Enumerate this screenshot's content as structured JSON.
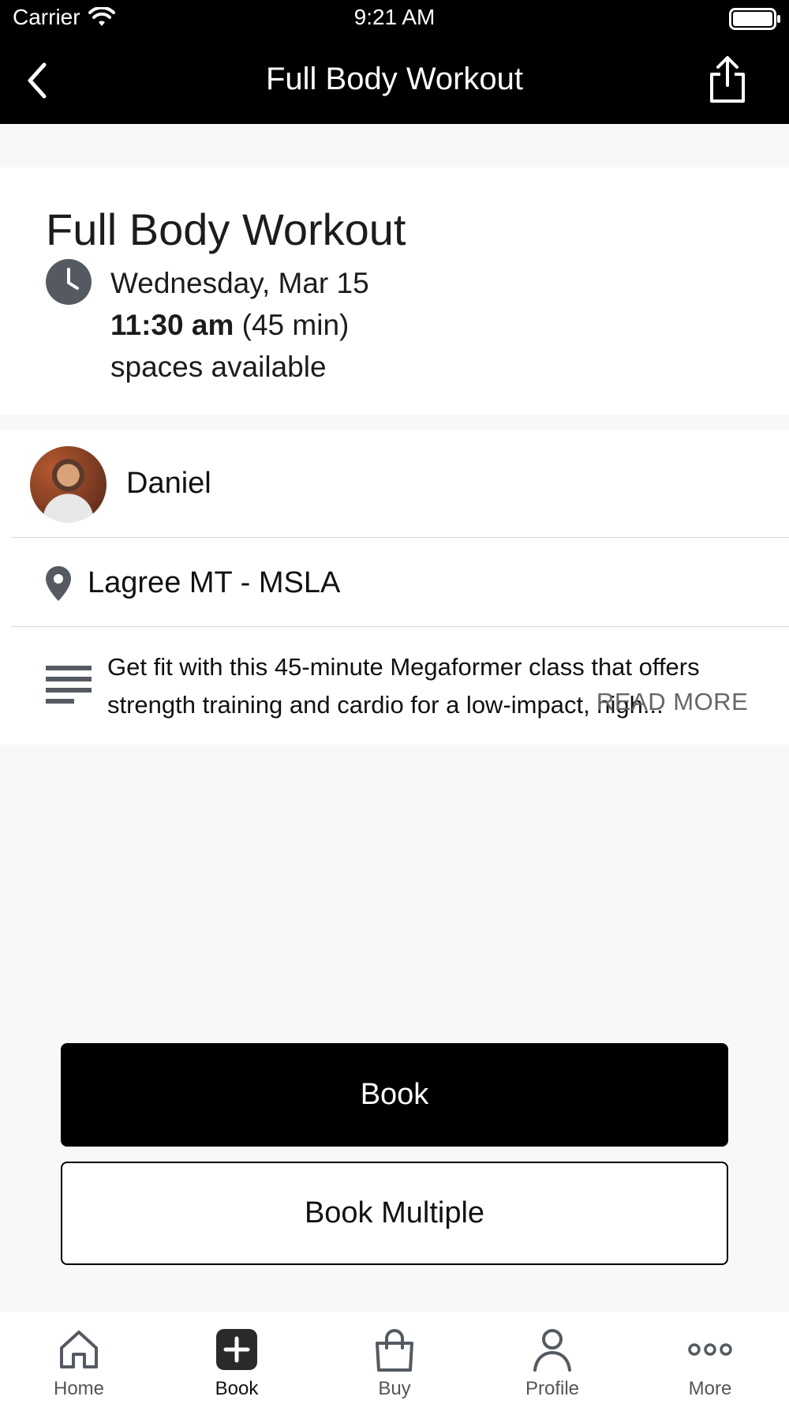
{
  "status_bar": {
    "carrier": "Carrier",
    "time": "9:21 AM"
  },
  "nav": {
    "title": "Full Body Workout"
  },
  "class": {
    "title": "Full Body Workout",
    "date": "Wednesday, Mar 15",
    "time": "11:30 am",
    "duration": "(45 min)",
    "availability": "spaces available"
  },
  "instructor": {
    "name": "Daniel"
  },
  "location": {
    "name": "Lagree MT - MSLA"
  },
  "description": {
    "text": "Get fit with this 45-minute Megaformer class that offers strength training and cardio for a low-impact, high...",
    "read_more": "READ MORE"
  },
  "buttons": {
    "book": "Book",
    "book_multiple": "Book Multiple"
  },
  "tabs": [
    {
      "label": "Home",
      "icon": "home-icon"
    },
    {
      "label": "Book",
      "icon": "plus-square-icon"
    },
    {
      "label": "Buy",
      "icon": "shopping-bag-icon"
    },
    {
      "label": "Profile",
      "icon": "person-icon"
    },
    {
      "label": "More",
      "icon": "ellipsis-icon"
    }
  ],
  "colors": {
    "header": "#000000",
    "primary_button": "#000000",
    "background": "#f7f8fa",
    "icon_gray": "#555555"
  }
}
